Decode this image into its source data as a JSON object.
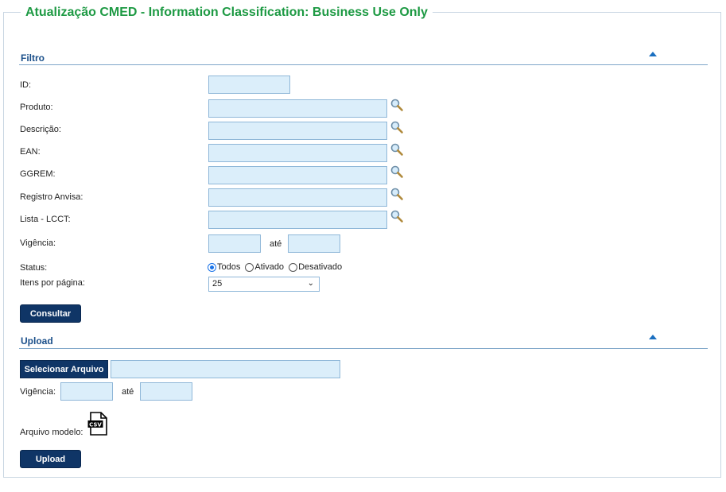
{
  "page": {
    "title": "Atualização CMED - Information Classification: Business Use Only"
  },
  "filtro": {
    "title": "Filtro",
    "fields": {
      "id": {
        "label": "ID:",
        "value": ""
      },
      "produto": {
        "label": "Produto:",
        "value": ""
      },
      "descricao": {
        "label": "Descrição:",
        "value": ""
      },
      "ean": {
        "label": "EAN:",
        "value": ""
      },
      "ggrem": {
        "label": "GGREM:",
        "value": ""
      },
      "registro": {
        "label": "Registro Anvisa:",
        "value": ""
      },
      "lista": {
        "label": "Lista - LCCT:",
        "value": ""
      }
    },
    "vigencia": {
      "label": "Vigência:",
      "from": "",
      "to": "",
      "separator": "até"
    },
    "status": {
      "label": "Status:",
      "options": [
        "Todos",
        "Ativado",
        "Desativado"
      ],
      "selected": "Todos"
    },
    "itens": {
      "label": "Itens por página:",
      "selected": "25"
    },
    "consultar_label": "Consultar"
  },
  "upload": {
    "title": "Upload",
    "select_label": "Selecionar Arquivo",
    "file_value": "",
    "vigencia": {
      "label": "Vigência:",
      "from": "",
      "to": "",
      "separator": "até"
    },
    "modelo_label": "Arquivo modelo:",
    "upload_label": "Upload"
  },
  "icons": {
    "lookup": "magnifier-icon",
    "collapse": "triangle-up-icon",
    "csv": "csv-file-icon"
  },
  "colors": {
    "title_green": "#1e9a44",
    "section_blue": "#1a4f8a",
    "button_navy": "#0f3566",
    "input_bg": "#dbeefa"
  }
}
